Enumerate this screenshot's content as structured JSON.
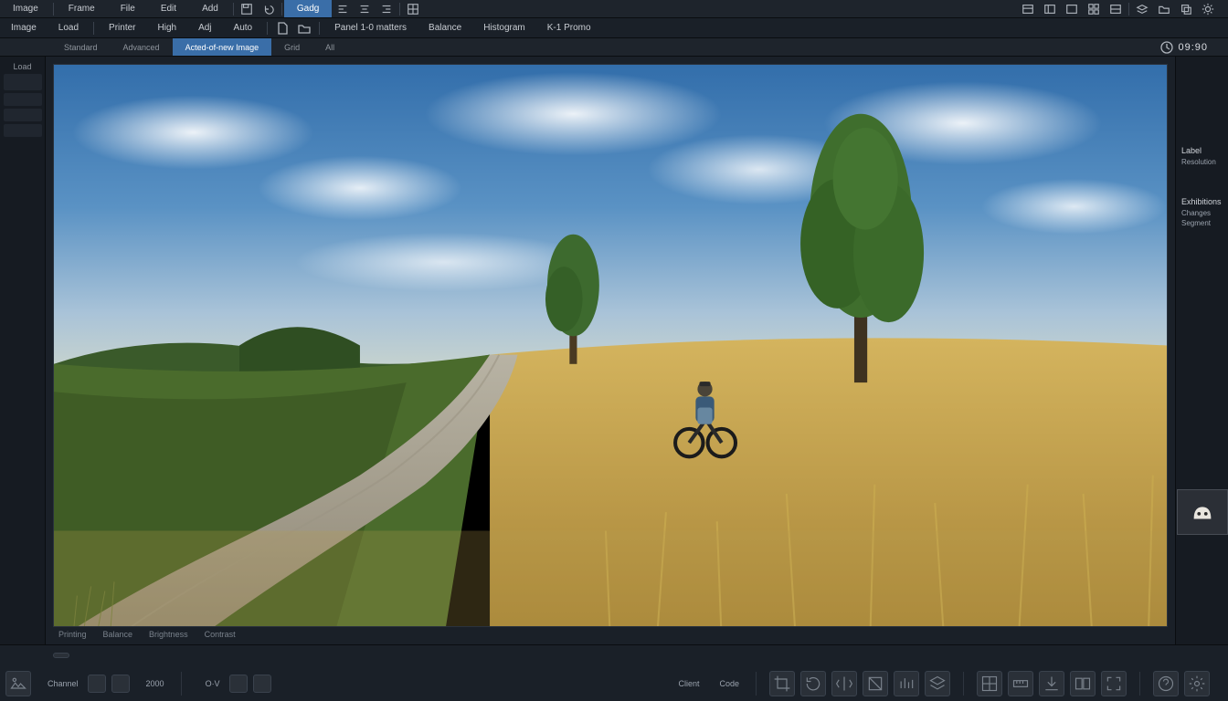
{
  "topmenu": {
    "items": [
      "Image",
      "",
      "Frame",
      "File",
      "Edit",
      "Add",
      "",
      "Gadg"
    ],
    "selected_index": 8,
    "rightgadgets": 10
  },
  "toolbar": {
    "left": [
      "Image",
      "Load"
    ],
    "mid": [
      "Printer",
      "High",
      "Adj",
      "Auto"
    ],
    "right": [
      "",
      "Panel 1-0 matters",
      "Balance",
      "Histogram",
      "K-1 Promo"
    ]
  },
  "tabs": {
    "items": [
      "Standard",
      "Advanced",
      "Acted-of-new Image",
      "Grid",
      "All"
    ],
    "selected_index": 2,
    "clock": "09:90"
  },
  "left_sidebar": {
    "label": "Load"
  },
  "canvas_status": {
    "items": [
      "",
      "Printing",
      "",
      "",
      "Balance",
      "Brightness",
      "Contrast",
      "",
      ""
    ]
  },
  "right_sidebar": {
    "section1": {
      "header": "Label",
      "rows": [
        "Resolution"
      ]
    },
    "section2": {
      "header": "Exhibitions",
      "rows": [
        "Changes",
        "Segment"
      ]
    }
  },
  "status": {
    "row1_left": "",
    "row2_labels": [
      "Channel",
      "",
      "2000",
      "",
      "",
      "O·V",
      "",
      "Client",
      "Code"
    ],
    "pills": [
      "",
      ""
    ]
  }
}
